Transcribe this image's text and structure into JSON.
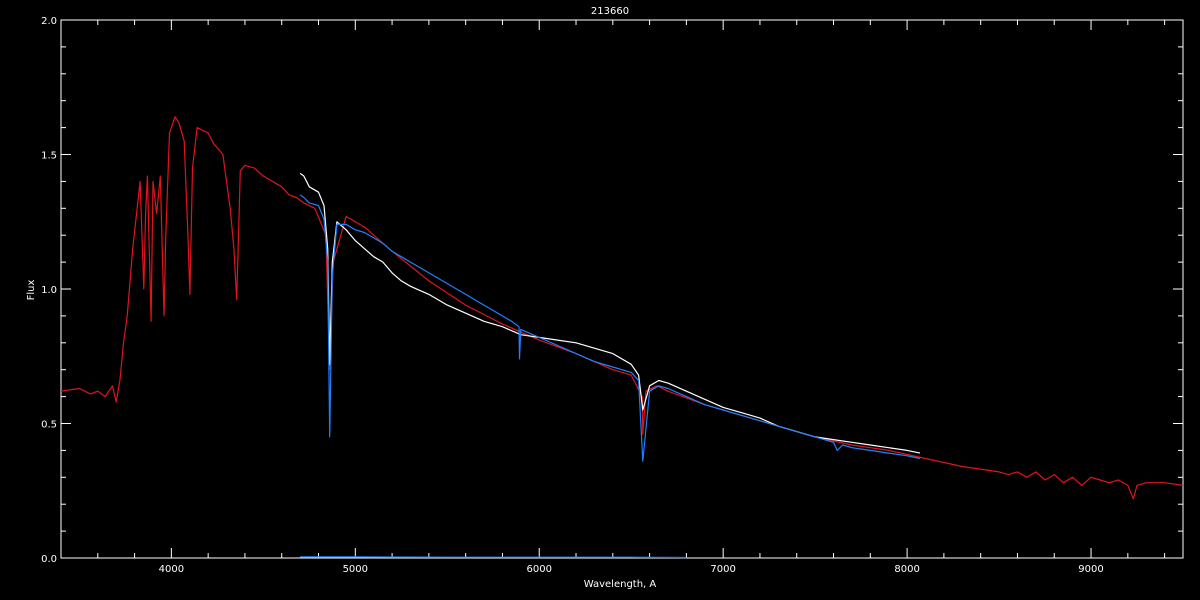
{
  "chart_data": {
    "type": "line",
    "title": "213660",
    "xlabel": "Wavelength, A",
    "ylabel": "Flux",
    "xlim": [
      3400,
      9500
    ],
    "ylim": [
      0.0,
      2.0
    ],
    "x_ticks": [
      4000,
      5000,
      6000,
      7000,
      8000,
      9000
    ],
    "x_tick_labels": [
      "4000",
      "5000",
      "6000",
      "7000",
      "8000",
      "9000"
    ],
    "y_ticks": [
      0.0,
      0.5,
      1.0,
      1.5,
      2.0
    ],
    "y_tick_labels": [
      "0.0",
      "0.5",
      "1.0",
      "1.5",
      "2.0"
    ],
    "grid": false,
    "colors": {
      "background": "#000000",
      "axes": "#ffffff",
      "model": "#e0141e",
      "observed": "#ffffff",
      "fit": "#1e82ff"
    },
    "series": [
      {
        "color": "#e0141e",
        "x": [
          3400,
          3500,
          3560,
          3600,
          3640,
          3680,
          3700,
          3720,
          3740,
          3760,
          3790,
          3830,
          3850,
          3860,
          3870,
          3890,
          3900,
          3920,
          3940,
          3960,
          3970,
          3990,
          4020,
          4040,
          4070,
          4090,
          4101,
          4115,
          4140,
          4170,
          4200,
          4230,
          4280,
          4300,
          4320,
          4340,
          4355,
          4375,
          4400,
          4450,
          4500,
          4550,
          4600,
          4640,
          4680,
          4720,
          4780,
          4840,
          4861,
          4880,
          4950,
          5050,
          5200,
          5400,
          5600,
          5800,
          6000,
          6200,
          6400,
          6500,
          6560,
          6563,
          6580,
          6640,
          6700,
          6900,
          7100,
          7300,
          7500,
          7700,
          7900,
          8100,
          8300,
          8500,
          8550,
          8600,
          8650,
          8700,
          8750,
          8800,
          8850,
          8900,
          8950,
          9000,
          9050,
          9100,
          9150,
          9200,
          9230,
          9250,
          9300,
          9400,
          9500
        ],
        "y": [
          0.62,
          0.63,
          0.61,
          0.62,
          0.6,
          0.64,
          0.58,
          0.66,
          0.8,
          0.9,
          1.15,
          1.4,
          1.0,
          1.28,
          1.42,
          0.88,
          1.4,
          1.28,
          1.42,
          0.9,
          1.2,
          1.58,
          1.64,
          1.62,
          1.55,
          1.2,
          0.98,
          1.45,
          1.6,
          1.59,
          1.58,
          1.54,
          1.5,
          1.4,
          1.3,
          1.15,
          0.96,
          1.44,
          1.46,
          1.45,
          1.42,
          1.4,
          1.38,
          1.35,
          1.34,
          1.32,
          1.3,
          1.2,
          0.7,
          1.1,
          1.27,
          1.23,
          1.14,
          1.03,
          0.94,
          0.87,
          0.81,
          0.76,
          0.7,
          0.68,
          0.6,
          0.46,
          0.62,
          0.64,
          0.62,
          0.57,
          0.53,
          0.49,
          0.45,
          0.42,
          0.4,
          0.37,
          0.34,
          0.32,
          0.31,
          0.32,
          0.3,
          0.32,
          0.29,
          0.31,
          0.28,
          0.3,
          0.27,
          0.3,
          0.29,
          0.28,
          0.29,
          0.27,
          0.22,
          0.27,
          0.28,
          0.28,
          0.27
        ]
      },
      {
        "color": "#ffffff",
        "x": [
          4700,
          4720,
          4750,
          4800,
          4830,
          4850,
          4861,
          4875,
          4900,
          4950,
          5000,
          5050,
          5100,
          5150,
          5200,
          5250,
          5300,
          5400,
          5500,
          5600,
          5700,
          5800,
          5900,
          6000,
          6100,
          6200,
          6300,
          6400,
          6500,
          6540,
          6563,
          6600,
          6650,
          6700,
          6800,
          6900,
          7000,
          7100,
          7200,
          7300,
          7400,
          7500,
          7600,
          7700,
          7800,
          7900,
          8000,
          8070
        ],
        "y": [
          1.43,
          1.42,
          1.38,
          1.36,
          1.31,
          1.15,
          0.72,
          1.1,
          1.25,
          1.22,
          1.18,
          1.15,
          1.12,
          1.1,
          1.06,
          1.03,
          1.01,
          0.98,
          0.94,
          0.91,
          0.88,
          0.86,
          0.83,
          0.82,
          0.81,
          0.8,
          0.78,
          0.76,
          0.72,
          0.68,
          0.55,
          0.64,
          0.66,
          0.65,
          0.62,
          0.59,
          0.56,
          0.54,
          0.52,
          0.49,
          0.47,
          0.45,
          0.44,
          0.43,
          0.42,
          0.41,
          0.4,
          0.39
        ]
      },
      {
        "color": "#1e82ff",
        "x": [
          4700,
          4720,
          4750,
          4800,
          4830,
          4850,
          4861,
          4875,
          4900,
          4950,
          5000,
          5050,
          5100,
          5150,
          5200,
          5250,
          5300,
          5400,
          5500,
          5600,
          5700,
          5800,
          5850,
          5890,
          5893,
          5900,
          6000,
          6100,
          6200,
          6300,
          6400,
          6500,
          6540,
          6563,
          6600,
          6650,
          6700,
          6800,
          6900,
          7000,
          7100,
          7200,
          7300,
          7400,
          7500,
          7600,
          7620,
          7650,
          7700,
          7800,
          7900,
          8000,
          8070
        ],
        "y": [
          1.35,
          1.34,
          1.32,
          1.31,
          1.26,
          1.1,
          0.45,
          1.05,
          1.24,
          1.24,
          1.22,
          1.21,
          1.19,
          1.17,
          1.14,
          1.12,
          1.1,
          1.06,
          1.02,
          0.98,
          0.94,
          0.9,
          0.88,
          0.86,
          0.74,
          0.85,
          0.82,
          0.79,
          0.76,
          0.73,
          0.71,
          0.69,
          0.66,
          0.36,
          0.62,
          0.64,
          0.63,
          0.6,
          0.57,
          0.55,
          0.53,
          0.51,
          0.49,
          0.47,
          0.45,
          0.43,
          0.4,
          0.42,
          0.41,
          0.4,
          0.39,
          0.38,
          0.37
        ]
      },
      {
        "color": "#1e82ff",
        "x": [
          4700,
          5000,
          5500,
          6000,
          6500,
          6800
        ],
        "y": [
          0.004,
          0.004,
          0.003,
          0.003,
          0.003,
          0.002
        ]
      }
    ]
  }
}
